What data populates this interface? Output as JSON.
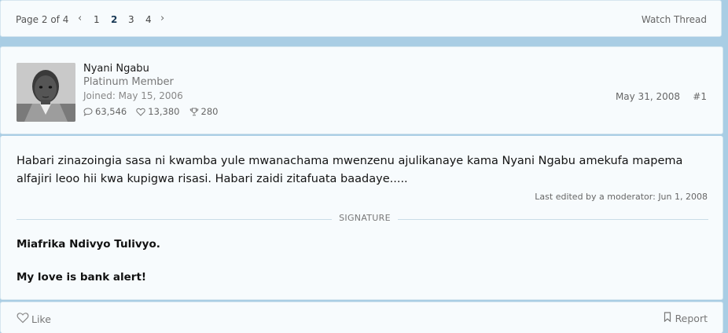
{
  "pagination": {
    "label": "Page 2 of 4",
    "prev": "‹",
    "next": "›",
    "pages": [
      "1",
      "2",
      "3",
      "4"
    ],
    "current": "2",
    "watch": "Watch Thread"
  },
  "post": {
    "author": {
      "name": "Nyani Ngabu",
      "title": "Platinum Member",
      "joined": "Joined: May 15, 2006",
      "messages": "63,546",
      "reactions": "13,380",
      "points": "280"
    },
    "date": "May 31, 2008",
    "number": "#1",
    "text": "Habari zinazoingia sasa ni kwamba yule mwanachama mwenzenu ajulikanaye kama Nyani Ngabu amekufa mapema alfajiri leoo hii kwa kupigwa risasi. Habari zaidi zitafuata baadaye.....",
    "edited": "Last edited by a moderator: Jun 1, 2008",
    "signature_label": "SIGNATURE",
    "signature": [
      "Miafrika Ndivyo Tulivyo.",
      "My love is bank alert!"
    ]
  },
  "actions": {
    "like": "Like",
    "report": "Report"
  },
  "colors": {
    "page_bg": "#a9cde4",
    "panel_bg": "#f7fbfd",
    "current_page": "#1a3a56"
  }
}
